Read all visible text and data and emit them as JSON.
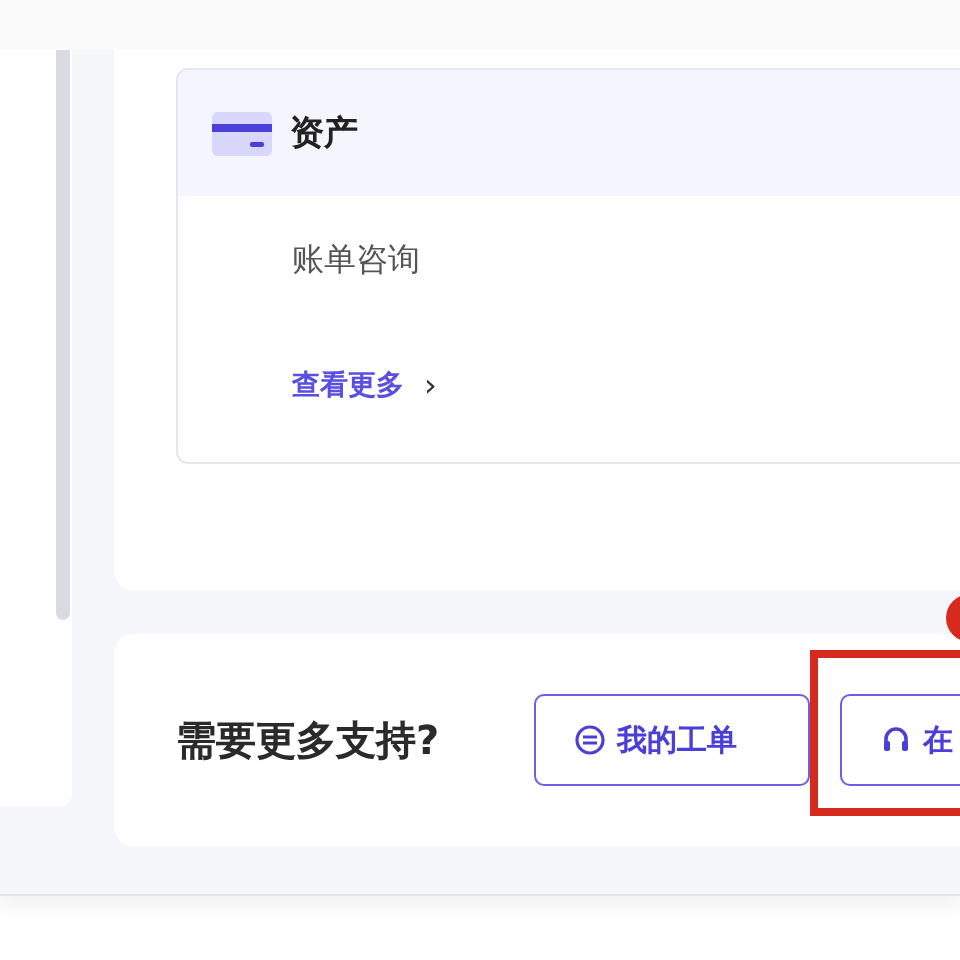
{
  "asset_card": {
    "title": "资产",
    "items": [
      "账单咨询"
    ],
    "more_link": "查看更多",
    "more_icon": "›"
  },
  "support": {
    "title": "需要更多支持?",
    "buttons": [
      {
        "label": "我的工单",
        "kind": "ticket"
      },
      {
        "label": "在",
        "kind": "headset"
      }
    ]
  }
}
